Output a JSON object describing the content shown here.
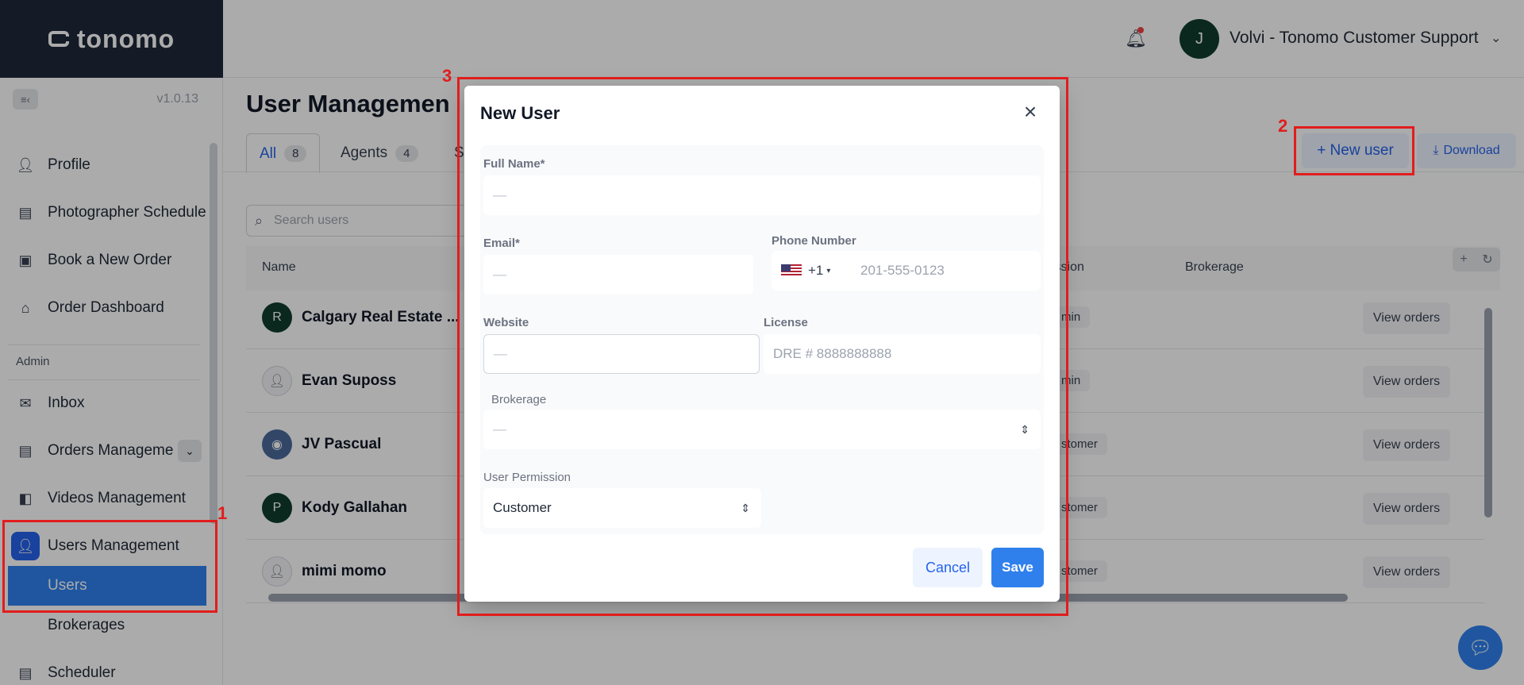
{
  "brand": {
    "name": "tonomo"
  },
  "sidebar": {
    "version": "v1.0.13",
    "items": [
      {
        "label": "Profile",
        "icon": "person-icon"
      },
      {
        "label": "Photographer Schedule",
        "icon": "calendar-icon"
      },
      {
        "label": "Book a New Order",
        "icon": "image-icon"
      },
      {
        "label": "Order Dashboard",
        "icon": "home-icon"
      }
    ],
    "section_admin": "Admin",
    "admin_items": [
      {
        "label": "Inbox",
        "icon": "mail-icon"
      },
      {
        "label": "Orders Manageme",
        "icon": "orders-icon"
      },
      {
        "label": "Videos Management",
        "icon": "video-icon"
      },
      {
        "label": "Users Management",
        "icon": "users-icon"
      }
    ],
    "sub_items": [
      {
        "label": "Users"
      },
      {
        "label": "Brokerages"
      }
    ],
    "scheduler": "Scheduler"
  },
  "header": {
    "user_initial": "J",
    "user_name": "Volvi - Tonomo Customer Support"
  },
  "main": {
    "title": "User Managemen",
    "tabs": [
      {
        "label": "All",
        "count": "8"
      },
      {
        "label": "Agents",
        "count": "4"
      },
      {
        "label": "S"
      }
    ],
    "new_user_label": "+ New user",
    "download_label": "Download",
    "search_placeholder": "Search users",
    "columns": {
      "name": "Name",
      "permission": "ission",
      "brokerage": "Brokerage"
    },
    "rows": [
      {
        "name": "Calgary Real Estate ...",
        "initial": "R",
        "perm": "min",
        "action": "View orders"
      },
      {
        "name": "Evan Suposs",
        "initial": "",
        "perm": "min",
        "action": "View orders"
      },
      {
        "name": "JV Pascual",
        "initial": "",
        "perm": "stomer",
        "action": "View orders"
      },
      {
        "name": "Kody Gallahan",
        "initial": "P",
        "perm": "stomer",
        "action": "View orders"
      },
      {
        "name": "mimi momo",
        "initial": "",
        "perm": "stomer",
        "action": "View orders"
      }
    ]
  },
  "modal": {
    "title": "New User",
    "full_name_label": "Full Name*",
    "full_name_placeholder": "—",
    "email_label": "Email*",
    "email_placeholder": "—",
    "phone_label": "Phone Number",
    "phone_code": "+1",
    "phone_placeholder": "201-555-0123",
    "website_label": "Website",
    "website_placeholder": "—",
    "license_label": "License",
    "license_placeholder": "DRE # 8888888888",
    "brokerage_label": "Brokerage",
    "brokerage_value": "—",
    "permission_label": "User Permission",
    "permission_value": "Customer",
    "cancel_label": "Cancel",
    "save_label": "Save"
  },
  "annotations": [
    "1",
    "2",
    "3"
  ],
  "colors": {
    "accent": "#2f80ed",
    "annotation": "#e11d1d",
    "brand_bg": "#1e293b"
  }
}
